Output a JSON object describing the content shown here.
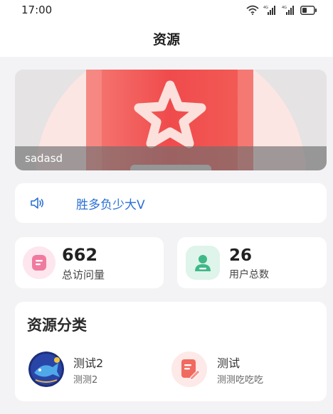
{
  "status_bar": {
    "time": "17:00",
    "icons": [
      "wifi-icon",
      "signal-4g-icon",
      "signal-4g-icon",
      "battery-icon"
    ]
  },
  "header": {
    "title": "资源"
  },
  "banner": {
    "caption": "sadasd",
    "icon": "star-icon"
  },
  "notice": {
    "icon": "speaker-icon",
    "text": "胜多负少大V"
  },
  "stats": [
    {
      "value": "662",
      "label": "总访问量",
      "icon": "document-icon",
      "color": "#f07aa0"
    },
    {
      "value": "26",
      "label": "用户总数",
      "icon": "user-icon",
      "color": "#3fb887"
    }
  ],
  "categories": {
    "title": "资源分类",
    "items": [
      {
        "name": "测试2",
        "description": "测测2"
      },
      {
        "name": "测试",
        "description": "测测吃吃吃"
      }
    ]
  },
  "colors": {
    "accent_blue": "#2a6fd6",
    "background": "#f3f3f5",
    "banner_red": "#f0524f"
  }
}
